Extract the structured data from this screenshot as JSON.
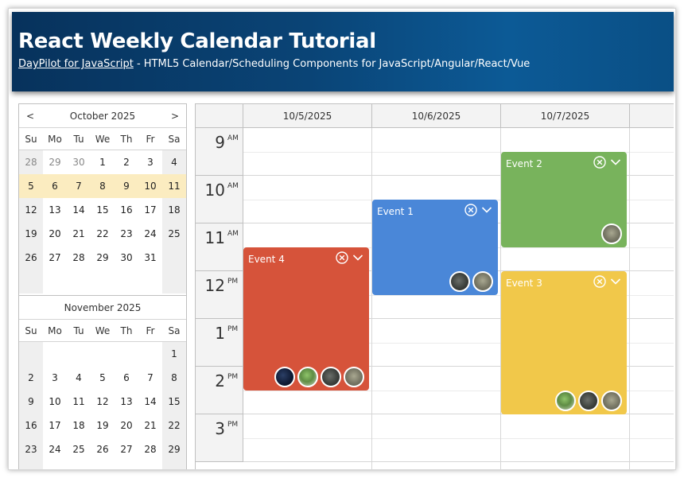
{
  "header": {
    "title": "React Weekly Calendar Tutorial",
    "link_text": "DayPilot for JavaScript",
    "subtitle_rest": " - HTML5 Calendar/Scheduling Components for JavaScript/Angular/React/Vue"
  },
  "navigator": {
    "prev_label": "<",
    "next_label": ">",
    "day_names": [
      "Su",
      "Mo",
      "Tu",
      "We",
      "Th",
      "Fr",
      "Sa"
    ],
    "months": [
      {
        "title": "October 2025",
        "weeks": [
          [
            {
              "d": "28",
              "other": true
            },
            {
              "d": "29",
              "other": true
            },
            {
              "d": "30",
              "other": true
            },
            {
              "d": "1"
            },
            {
              "d": "2"
            },
            {
              "d": "3"
            },
            {
              "d": "4"
            }
          ],
          [
            {
              "d": "5"
            },
            {
              "d": "6"
            },
            {
              "d": "7"
            },
            {
              "d": "8"
            },
            {
              "d": "9"
            },
            {
              "d": "10"
            },
            {
              "d": "11"
            }
          ],
          [
            {
              "d": "12"
            },
            {
              "d": "13"
            },
            {
              "d": "14"
            },
            {
              "d": "15"
            },
            {
              "d": "16"
            },
            {
              "d": "17"
            },
            {
              "d": "18"
            }
          ],
          [
            {
              "d": "19"
            },
            {
              "d": "20"
            },
            {
              "d": "21"
            },
            {
              "d": "22"
            },
            {
              "d": "23"
            },
            {
              "d": "24"
            },
            {
              "d": "25"
            }
          ],
          [
            {
              "d": "26"
            },
            {
              "d": "27"
            },
            {
              "d": "28"
            },
            {
              "d": "29"
            },
            {
              "d": "30"
            },
            {
              "d": "31"
            },
            {
              "d": ""
            }
          ]
        ],
        "selected_week_index": 1
      },
      {
        "title": "November 2025",
        "weeks": [
          [
            {
              "d": ""
            },
            {
              "d": ""
            },
            {
              "d": ""
            },
            {
              "d": ""
            },
            {
              "d": ""
            },
            {
              "d": ""
            },
            {
              "d": "1"
            }
          ],
          [
            {
              "d": "2"
            },
            {
              "d": "3"
            },
            {
              "d": "4"
            },
            {
              "d": "5"
            },
            {
              "d": "6"
            },
            {
              "d": "7"
            },
            {
              "d": "8"
            }
          ],
          [
            {
              "d": "9"
            },
            {
              "d": "10"
            },
            {
              "d": "11"
            },
            {
              "d": "12"
            },
            {
              "d": "13"
            },
            {
              "d": "14"
            },
            {
              "d": "15"
            }
          ],
          [
            {
              "d": "16"
            },
            {
              "d": "17"
            },
            {
              "d": "18"
            },
            {
              "d": "19"
            },
            {
              "d": "20"
            },
            {
              "d": "21"
            },
            {
              "d": "22"
            }
          ],
          [
            {
              "d": "23"
            },
            {
              "d": "24"
            },
            {
              "d": "25"
            },
            {
              "d": "26"
            },
            {
              "d": "27"
            },
            {
              "d": "28"
            },
            {
              "d": "29"
            }
          ]
        ],
        "selected_week_index": -1
      }
    ]
  },
  "calendar": {
    "columns": [
      "10/5/2025",
      "10/6/2025",
      "10/7/2025"
    ],
    "hours": [
      {
        "num": "9",
        "ampm": "AM"
      },
      {
        "num": "10",
        "ampm": "AM"
      },
      {
        "num": "11",
        "ampm": "AM"
      },
      {
        "num": "12",
        "ampm": "PM"
      },
      {
        "num": "1",
        "ampm": "PM"
      },
      {
        "num": "2",
        "ampm": "PM"
      },
      {
        "num": "3",
        "ampm": "PM"
      }
    ],
    "events": [
      {
        "title": "Event 4",
        "column": 0,
        "start_hour": 11.5,
        "end_hour": 14.5,
        "color": "#d6533a",
        "avatars": [
          "dark-blue",
          "green-plant",
          "dark-gray",
          "gray-green"
        ]
      },
      {
        "title": "Event 1",
        "column": 1,
        "start_hour": 10.5,
        "end_hour": 12.5,
        "color": "#4a87d8",
        "avatars": [
          "dark-gray",
          "gray-green"
        ]
      },
      {
        "title": "Event 2",
        "column": 2,
        "start_hour": 9.5,
        "end_hour": 11.5,
        "color": "#78b35c",
        "avatars": [
          "gray-green"
        ]
      },
      {
        "title": "Event 3",
        "column": 2,
        "start_hour": 12.0,
        "end_hour": 15.0,
        "color": "#f1c84a",
        "avatars": [
          "green-plant",
          "dark-gray",
          "gray-green"
        ]
      }
    ]
  }
}
